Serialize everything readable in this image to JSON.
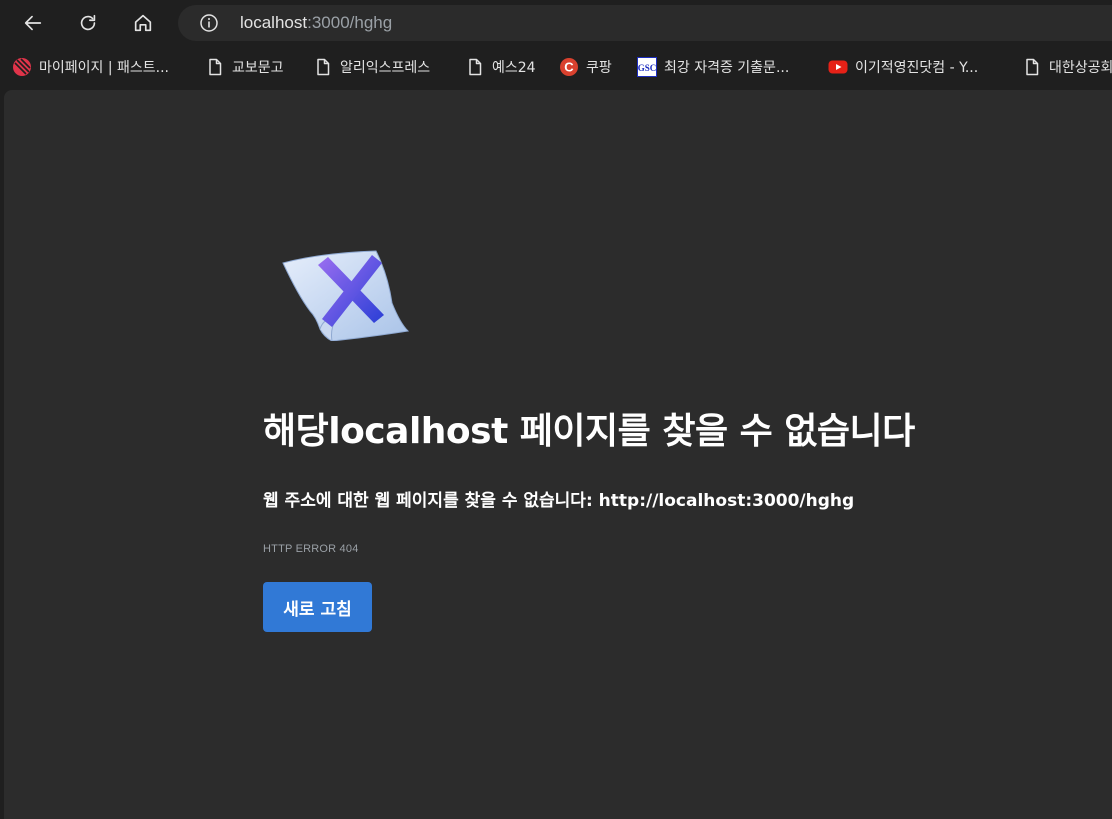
{
  "browser": {
    "address_bar": {
      "host": "localhost",
      "path": ":3000/hghg"
    }
  },
  "bookmarks": [
    {
      "label": "마이페이지 | 패스트...",
      "icon": "red-striped-ball-icon"
    },
    {
      "label": "교보문고",
      "icon": "page-icon"
    },
    {
      "label": "알리익스프레스",
      "icon": "page-icon"
    },
    {
      "label": "예스24",
      "icon": "page-icon"
    },
    {
      "label": "쿠팡",
      "icon": "coupang-c-icon"
    },
    {
      "label": "최강 자격증 기출문...",
      "icon": "gsc-logo-icon"
    },
    {
      "label": "이기적영진닷컴 - Y...",
      "icon": "youtube-icon"
    },
    {
      "label": "대한상공회",
      "icon": "page-icon"
    }
  ],
  "error_page": {
    "headline": "해당localhost 페이지를 찾을 수 없습니다",
    "subline": "웹 주소에 대한 웹 페이지를 찾을 수 없습니다: http://localhost:3000/hghg",
    "error_code": "HTTP ERROR 404",
    "reload_label": "새로 고침"
  },
  "colors": {
    "page_background": "#2c2c2c",
    "browser_chrome": "#1f1f1f",
    "button_blue": "#3179d6"
  }
}
